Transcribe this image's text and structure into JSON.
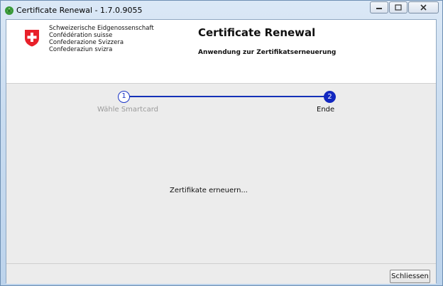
{
  "window": {
    "title": "Certificate Renewal - 1.7.0.9055",
    "icon": "recycle-icon"
  },
  "header": {
    "confederation_lines": [
      "Schweizerische Eidgenossenschaft",
      "Confédération suisse",
      "Confederazione Svizzera",
      "Confederaziun svizra"
    ],
    "title": "Certificate Renewal",
    "subtitle": "Anwendung zur Zertifikatserneuerung"
  },
  "wizard": {
    "steps": [
      {
        "number": "1",
        "label": "Wähle Smartcard",
        "state": "completed"
      },
      {
        "number": "2",
        "label": "Ende",
        "state": "active"
      }
    ],
    "accent_color": "#1227c0"
  },
  "main": {
    "status_text": "Zertifikate erneuern..."
  },
  "footer": {
    "close_label": "Schliessen"
  }
}
